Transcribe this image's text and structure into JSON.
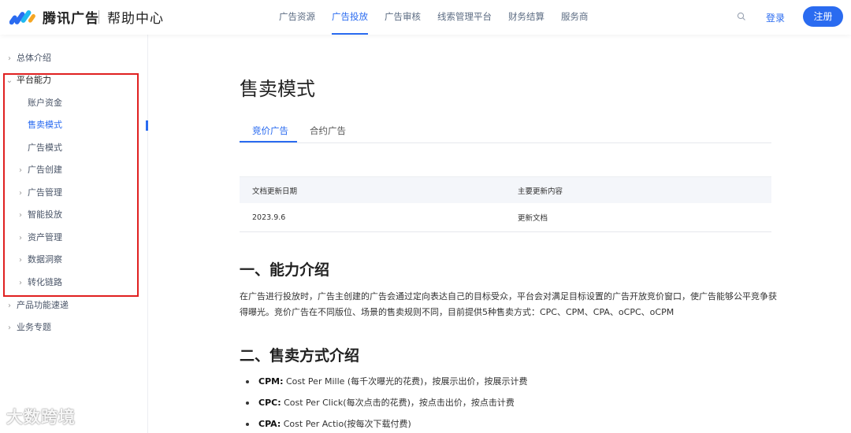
{
  "header": {
    "brand": "腾讯广告",
    "help": "帮助中心",
    "nav": [
      {
        "label": "广告资源",
        "active": false
      },
      {
        "label": "广告投放",
        "active": true
      },
      {
        "label": "广告审核",
        "active": false
      },
      {
        "label": "线索管理平台",
        "active": false
      },
      {
        "label": "财务结算",
        "active": false
      },
      {
        "label": "服务商",
        "active": false
      }
    ],
    "search_icon": "search-icon",
    "login": "登录",
    "register": "注册"
  },
  "sidebar": {
    "items": [
      {
        "label": "总体介绍",
        "chev": "›",
        "level": 0
      },
      {
        "label": "平台能力",
        "chev": "⌄",
        "level": 0
      },
      {
        "label": "账户资金",
        "chev": "",
        "level": 2
      },
      {
        "label": "售卖模式",
        "chev": "",
        "level": 2,
        "active": true
      },
      {
        "label": "广告模式",
        "chev": "",
        "level": 2
      },
      {
        "label": "广告创建",
        "chev": "›",
        "level": 1
      },
      {
        "label": "广告管理",
        "chev": "›",
        "level": 1
      },
      {
        "label": "智能投放",
        "chev": "›",
        "level": 1
      },
      {
        "label": "资产管理",
        "chev": "›",
        "level": 1
      },
      {
        "label": "数据洞察",
        "chev": "›",
        "level": 1
      },
      {
        "label": "转化链路",
        "chev": "›",
        "level": 1
      },
      {
        "label": "产品功能速递",
        "chev": "›",
        "level": 0
      },
      {
        "label": "业务专题",
        "chev": "›",
        "level": 0
      }
    ]
  },
  "main": {
    "title": "售卖模式",
    "tabs": [
      {
        "label": "竞价广告",
        "active": true
      },
      {
        "label": "合约广告",
        "active": false
      }
    ],
    "table": {
      "headers": [
        "文档更新日期",
        "主要更新内容"
      ],
      "rows": [
        [
          "2023.9.6",
          "更新文档"
        ]
      ]
    },
    "section1_title": "一、能力介绍",
    "section1_text": "在广告进行投放时，广告主创建的广告会通过定向表达自己的目标受众，平台会对满足目标设置的广告开放竞价窗口，使广告能够公平竞争获得曝光。竞价广告在不同版位、场景的售卖规则不同，目前提供5种售卖方式：CPC、CPM、CPA、oCPC、oCPM",
    "section2_title": "二、售卖方式介绍",
    "bullets": [
      {
        "term": "CPM:",
        "text": " Cost Per Mille (每千次曝光的花费)，按展示出价，按展示计费"
      },
      {
        "term": "CPC:",
        "text": " Cost Per Click(每次点击的花费)，按点击出价，按点击计费"
      },
      {
        "term": "CPA:",
        "text": " Cost Per Actio(按每次下载付费)"
      }
    ]
  },
  "watermark": "大数跨境",
  "colors": {
    "accent": "#2a6bf0",
    "highlight_box": "#e02020"
  }
}
